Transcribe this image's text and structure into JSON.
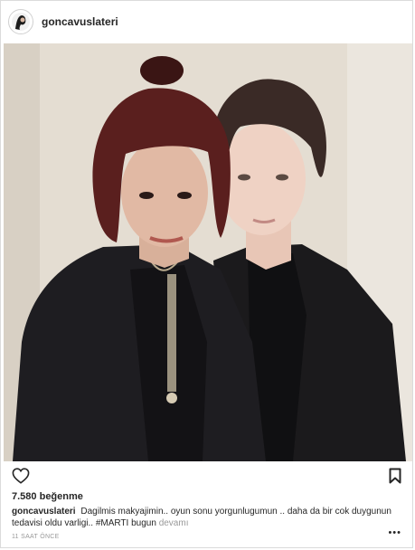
{
  "header": {
    "username": "goncavuslateri"
  },
  "actions": {
    "like_icon": "heart-outline-icon",
    "save_icon": "bookmark-outline-icon",
    "options_icon": "ellipsis-icon",
    "options_label": "•••"
  },
  "likes": {
    "count": "7.580",
    "label": "beğenme"
  },
  "caption": {
    "username": "goncavuslateri",
    "text": "Dagilmis makyajimin.. oyun sonu yorgunlugumun .. daha da bir cok duygunun tedavisi oldu varligi.. #MARTI bugun",
    "more_label": "devamı"
  },
  "timestamp": "11 SAAT ÖNCE",
  "colors": {
    "text": "#262626",
    "muted": "#999999",
    "border": "#dbdbdb"
  }
}
